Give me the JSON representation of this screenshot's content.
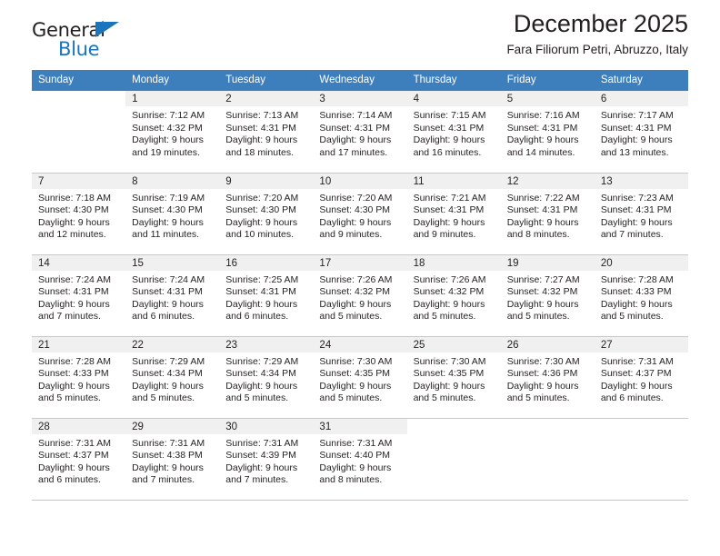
{
  "brand": {
    "name_part1": "General",
    "name_part2": "Blue",
    "triangle_color": "#1b75bc",
    "text_color": "#231f20"
  },
  "header": {
    "title": "December 2025",
    "subtitle": "Fara Filiorum Petri, Abruzzo, Italy",
    "header_bg": "#3d7ebc",
    "header_text_color": "#ffffff",
    "daynum_bg": "#f0f0f0"
  },
  "weekdays": [
    "Sunday",
    "Monday",
    "Tuesday",
    "Wednesday",
    "Thursday",
    "Friday",
    "Saturday"
  ],
  "labels": {
    "sunrise": "Sunrise:",
    "sunset": "Sunset:",
    "daylight": "Daylight:"
  },
  "weeks": [
    [
      {
        "day": "",
        "blank": true,
        "line1": "",
        "line2": "",
        "line3": "",
        "line4": ""
      },
      {
        "day": "1",
        "line1": "Sunrise: 7:12 AM",
        "line2": "Sunset: 4:32 PM",
        "line3": "Daylight: 9 hours",
        "line4": "and 19 minutes."
      },
      {
        "day": "2",
        "line1": "Sunrise: 7:13 AM",
        "line2": "Sunset: 4:31 PM",
        "line3": "Daylight: 9 hours",
        "line4": "and 18 minutes."
      },
      {
        "day": "3",
        "line1": "Sunrise: 7:14 AM",
        "line2": "Sunset: 4:31 PM",
        "line3": "Daylight: 9 hours",
        "line4": "and 17 minutes."
      },
      {
        "day": "4",
        "line1": "Sunrise: 7:15 AM",
        "line2": "Sunset: 4:31 PM",
        "line3": "Daylight: 9 hours",
        "line4": "and 16 minutes."
      },
      {
        "day": "5",
        "line1": "Sunrise: 7:16 AM",
        "line2": "Sunset: 4:31 PM",
        "line3": "Daylight: 9 hours",
        "line4": "and 14 minutes."
      },
      {
        "day": "6",
        "line1": "Sunrise: 7:17 AM",
        "line2": "Sunset: 4:31 PM",
        "line3": "Daylight: 9 hours",
        "line4": "and 13 minutes."
      }
    ],
    [
      {
        "day": "7",
        "line1": "Sunrise: 7:18 AM",
        "line2": "Sunset: 4:30 PM",
        "line3": "Daylight: 9 hours",
        "line4": "and 12 minutes."
      },
      {
        "day": "8",
        "line1": "Sunrise: 7:19 AM",
        "line2": "Sunset: 4:30 PM",
        "line3": "Daylight: 9 hours",
        "line4": "and 11 minutes."
      },
      {
        "day": "9",
        "line1": "Sunrise: 7:20 AM",
        "line2": "Sunset: 4:30 PM",
        "line3": "Daylight: 9 hours",
        "line4": "and 10 minutes."
      },
      {
        "day": "10",
        "line1": "Sunrise: 7:20 AM",
        "line2": "Sunset: 4:30 PM",
        "line3": "Daylight: 9 hours",
        "line4": "and 9 minutes."
      },
      {
        "day": "11",
        "line1": "Sunrise: 7:21 AM",
        "line2": "Sunset: 4:31 PM",
        "line3": "Daylight: 9 hours",
        "line4": "and 9 minutes."
      },
      {
        "day": "12",
        "line1": "Sunrise: 7:22 AM",
        "line2": "Sunset: 4:31 PM",
        "line3": "Daylight: 9 hours",
        "line4": "and 8 minutes."
      },
      {
        "day": "13",
        "line1": "Sunrise: 7:23 AM",
        "line2": "Sunset: 4:31 PM",
        "line3": "Daylight: 9 hours",
        "line4": "and 7 minutes."
      }
    ],
    [
      {
        "day": "14",
        "line1": "Sunrise: 7:24 AM",
        "line2": "Sunset: 4:31 PM",
        "line3": "Daylight: 9 hours",
        "line4": "and 7 minutes."
      },
      {
        "day": "15",
        "line1": "Sunrise: 7:24 AM",
        "line2": "Sunset: 4:31 PM",
        "line3": "Daylight: 9 hours",
        "line4": "and 6 minutes."
      },
      {
        "day": "16",
        "line1": "Sunrise: 7:25 AM",
        "line2": "Sunset: 4:31 PM",
        "line3": "Daylight: 9 hours",
        "line4": "and 6 minutes."
      },
      {
        "day": "17",
        "line1": "Sunrise: 7:26 AM",
        "line2": "Sunset: 4:32 PM",
        "line3": "Daylight: 9 hours",
        "line4": "and 5 minutes."
      },
      {
        "day": "18",
        "line1": "Sunrise: 7:26 AM",
        "line2": "Sunset: 4:32 PM",
        "line3": "Daylight: 9 hours",
        "line4": "and 5 minutes."
      },
      {
        "day": "19",
        "line1": "Sunrise: 7:27 AM",
        "line2": "Sunset: 4:32 PM",
        "line3": "Daylight: 9 hours",
        "line4": "and 5 minutes."
      },
      {
        "day": "20",
        "line1": "Sunrise: 7:28 AM",
        "line2": "Sunset: 4:33 PM",
        "line3": "Daylight: 9 hours",
        "line4": "and 5 minutes."
      }
    ],
    [
      {
        "day": "21",
        "line1": "Sunrise: 7:28 AM",
        "line2": "Sunset: 4:33 PM",
        "line3": "Daylight: 9 hours",
        "line4": "and 5 minutes."
      },
      {
        "day": "22",
        "line1": "Sunrise: 7:29 AM",
        "line2": "Sunset: 4:34 PM",
        "line3": "Daylight: 9 hours",
        "line4": "and 5 minutes."
      },
      {
        "day": "23",
        "line1": "Sunrise: 7:29 AM",
        "line2": "Sunset: 4:34 PM",
        "line3": "Daylight: 9 hours",
        "line4": "and 5 minutes."
      },
      {
        "day": "24",
        "line1": "Sunrise: 7:30 AM",
        "line2": "Sunset: 4:35 PM",
        "line3": "Daylight: 9 hours",
        "line4": "and 5 minutes."
      },
      {
        "day": "25",
        "line1": "Sunrise: 7:30 AM",
        "line2": "Sunset: 4:35 PM",
        "line3": "Daylight: 9 hours",
        "line4": "and 5 minutes."
      },
      {
        "day": "26",
        "line1": "Sunrise: 7:30 AM",
        "line2": "Sunset: 4:36 PM",
        "line3": "Daylight: 9 hours",
        "line4": "and 5 minutes."
      },
      {
        "day": "27",
        "line1": "Sunrise: 7:31 AM",
        "line2": "Sunset: 4:37 PM",
        "line3": "Daylight: 9 hours",
        "line4": "and 6 minutes."
      }
    ],
    [
      {
        "day": "28",
        "line1": "Sunrise: 7:31 AM",
        "line2": "Sunset: 4:37 PM",
        "line3": "Daylight: 9 hours",
        "line4": "and 6 minutes."
      },
      {
        "day": "29",
        "line1": "Sunrise: 7:31 AM",
        "line2": "Sunset: 4:38 PM",
        "line3": "Daylight: 9 hours",
        "line4": "and 7 minutes."
      },
      {
        "day": "30",
        "line1": "Sunrise: 7:31 AM",
        "line2": "Sunset: 4:39 PM",
        "line3": "Daylight: 9 hours",
        "line4": "and 7 minutes."
      },
      {
        "day": "31",
        "line1": "Sunrise: 7:31 AM",
        "line2": "Sunset: 4:40 PM",
        "line3": "Daylight: 9 hours",
        "line4": "and 8 minutes."
      },
      {
        "day": "",
        "blank": true,
        "line1": "",
        "line2": "",
        "line3": "",
        "line4": ""
      },
      {
        "day": "",
        "blank": true,
        "line1": "",
        "line2": "",
        "line3": "",
        "line4": ""
      },
      {
        "day": "",
        "blank": true,
        "line1": "",
        "line2": "",
        "line3": "",
        "line4": ""
      }
    ]
  ]
}
